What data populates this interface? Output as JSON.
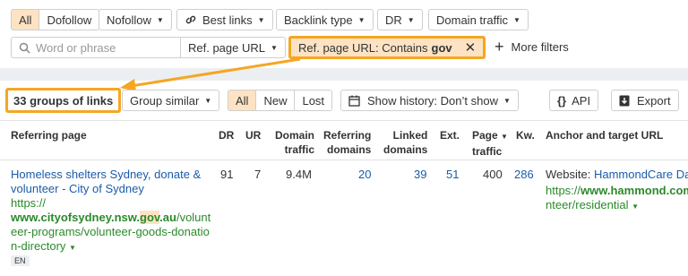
{
  "filters_row1": {
    "link_types": [
      "All",
      "Dofollow"
    ],
    "nofollow": "Nofollow",
    "best_links": "Best links",
    "backlink_type": "Backlink type",
    "dr": "DR",
    "domain_traffic": "Domain traffic"
  },
  "filters_row2": {
    "search_placeholder": "Word or phrase",
    "ref_page_url": "Ref. page URL",
    "chip_label": "Ref. page URL: Contains",
    "chip_value": "gov",
    "more_filters": "More filters"
  },
  "toolbar": {
    "groups_count": "33 groups of links",
    "group_similar": "Group similar",
    "tabs": [
      "All",
      "New",
      "Lost"
    ],
    "history": "Show history: Don’t show",
    "api": "API",
    "export": "Export"
  },
  "table": {
    "headers": {
      "referring_page": "Referring page",
      "dr": "DR",
      "ur": "UR",
      "domain_traffic_1": "Domain",
      "domain_traffic_2": "traffic",
      "ref_domains_1": "Referring",
      "ref_domains_2": "domains",
      "linked_domains_1": "Linked",
      "linked_domains_2": "domains",
      "ext": "Ext.",
      "page_traffic_1": "Page",
      "page_traffic_2": "traffic",
      "kw": "Kw.",
      "anchor": "Anchor and target URL"
    },
    "rows": [
      {
        "title_1": "Homeless shelters Sydney, donate &",
        "title_2": "volunteer - City of Sydney",
        "url_prefix": "https://",
        "url_domain_a": "www.cityofsydney.nsw.",
        "url_domain_hl": "gov",
        "url_domain_b": ".au",
        "url_path_1": "/volunt",
        "url_path_2": "eer-programs/volunteer-goods-donatio",
        "url_path_3": "n-directory",
        "lang": "EN",
        "dr": "91",
        "ur": "7",
        "domain_traffic": "9.4M",
        "ref_domains": "20",
        "linked_domains": "39",
        "ext": "51",
        "page_traffic": "400",
        "kw": "286",
        "anchor_label": "Website:",
        "anchor_text": "HammondCare Dar",
        "target_prefix": "https://",
        "target_domain": "www.hammond.com",
        "target_path": "nteer/residential"
      }
    ]
  }
}
